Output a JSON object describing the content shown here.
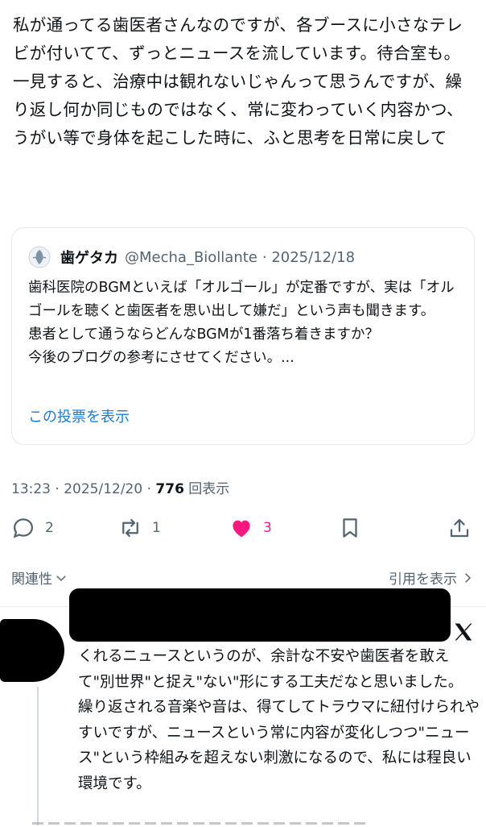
{
  "post": {
    "text": "私が通ってる歯医者さんなのですが、各ブースに小さなテレビが付いてて、ずっとニュースを流しています。待合室も。一見すると、治療中は観れないじゃんって思うんですが、繰り返し何か同じものではなく、常に変わっていく内容かつ、うがい等で身体を起こした時に、ふと思考を日常に戻して"
  },
  "quote": {
    "name": "歯ゲタカ",
    "handle": "@Mecha_Biollante",
    "date": "· 2025/12/18",
    "text": "歯科医院のBGMといえば「オルゴール」が定番ですが、実は「オルゴールを聴くと歯医者を思い出して嫌だ」という声も聞きます。\n患者として通うならどんなBGMが1番落ち着きますか？\n今後のブログの参考にさせてください。...",
    "poll_link": "この投票を表示"
  },
  "meta": {
    "time": "13:23 · 2025/12/20 · ",
    "views": "776",
    "views_label": " 回表示"
  },
  "actions": {
    "replies": "2",
    "reposts": "1",
    "likes": "3"
  },
  "filters": {
    "sort": "関連性",
    "quotes": "引用を表示"
  },
  "reply": {
    "text": "くれるニュースというのが、余計な不安や歯医者を敢えて\"別世界\"と捉え\"ない\"形にする工夫だなと思いました。\n繰り返される音楽や音は、得てしてトラウマに紐付けられやすいですが、ニュースという常に内容が変化しつつ\"ニュース\"という枠組みを超えない刺激になるので、私には程良い環境です。"
  },
  "icons": [
    "reply-icon",
    "repost-icon",
    "like-icon",
    "bookmark-icon",
    "share-icon",
    "chevron-down-icon",
    "chevron-right-icon",
    "x-logo-icon"
  ],
  "colors": {
    "like": "#f91880",
    "link": "#1d7bd0",
    "muted": "#536471"
  }
}
